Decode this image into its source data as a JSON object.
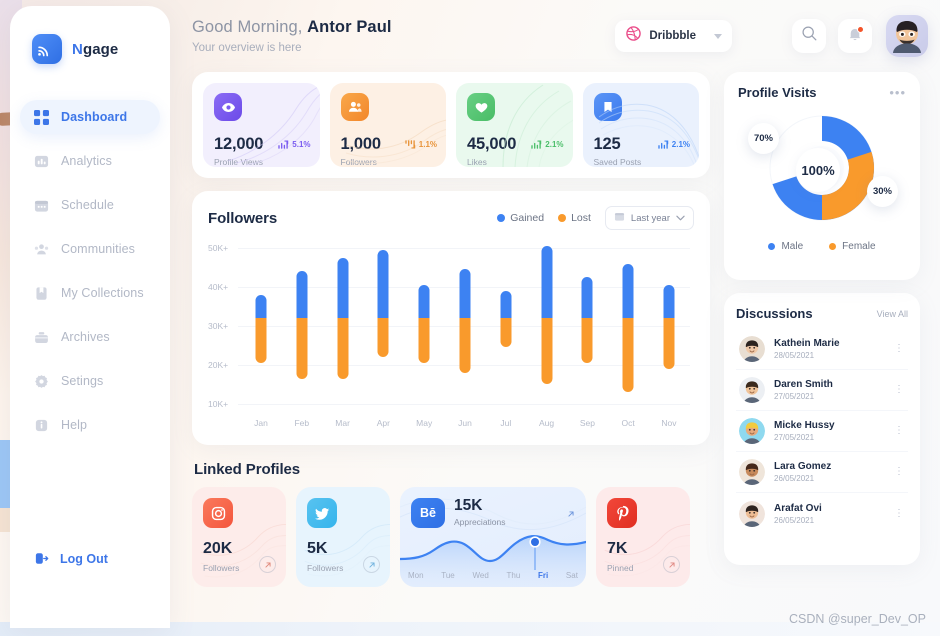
{
  "app": {
    "logo_n": "N",
    "logo_rest": "gage",
    "logo_icon": "cast-icon"
  },
  "sidebar": {
    "items": [
      {
        "label": "Dashboard",
        "icon": "grid-icon",
        "active": true
      },
      {
        "label": "Analytics",
        "icon": "bar-chart-icon",
        "active": false
      },
      {
        "label": "Schedule",
        "icon": "calendar-icon",
        "active": false
      },
      {
        "label": "Communities",
        "icon": "people-icon",
        "active": false
      },
      {
        "label": "My Collections",
        "icon": "bookmark-icon",
        "active": false
      },
      {
        "label": "Archives",
        "icon": "briefcase-icon",
        "active": false
      },
      {
        "label": "Setings",
        "icon": "gear-icon",
        "active": false
      },
      {
        "label": "Help",
        "icon": "info-icon",
        "active": false
      }
    ],
    "logout": {
      "label": "Log Out",
      "icon": "logout-icon"
    }
  },
  "header": {
    "greeting_prefix": "Good Morning, ",
    "user_name": "Antor Paul",
    "subtitle": "Your overview is here",
    "source_pill": {
      "label": "Dribbble",
      "icon": "dribbble-icon",
      "color": "#ea4c89"
    },
    "search_icon": "search-icon",
    "bell_icon": "bell-icon",
    "avatar": "user-avatar"
  },
  "stats": [
    {
      "value": "12,000",
      "label": "Profile Views",
      "change": "5.1%",
      "direction": "up",
      "icon": "eye-icon",
      "accent": "#7a5cf0",
      "bg": "#f1effd",
      "sq_from": "#8b6cf5",
      "sq_to": "#6c4ae8"
    },
    {
      "value": "1,000",
      "label": "Followers",
      "change": "1.1%",
      "direction": "down",
      "icon": "users-icon",
      "accent": "#f2922e",
      "bg": "#fdf0e4",
      "sq_from": "#f9a84a",
      "sq_to": "#f2862a"
    },
    {
      "value": "45,000",
      "label": "Likes",
      "change": "2.1%",
      "direction": "up",
      "icon": "heart-icon",
      "accent": "#4cbf6a",
      "bg": "#e9f9ee",
      "sq_from": "#68cf84",
      "sq_to": "#49bd66"
    },
    {
      "value": "125",
      "label": "Saved Posts",
      "change": "2.1%",
      "direction": "up",
      "icon": "bookmark-icon",
      "accent": "#3d82f2",
      "bg": "#eaf1fd",
      "sq_from": "#5b95f6",
      "sq_to": "#3b7aee"
    }
  ],
  "followers_chart": {
    "title": "Followers",
    "legend": [
      {
        "label": "Gained",
        "color": "#3d82f2"
      },
      {
        "label": "Lost",
        "color": "#f99a2c"
      }
    ],
    "range_select": {
      "label": "Last year",
      "icon": "calendar-icon"
    }
  },
  "chart_data": {
    "type": "bar",
    "title": "Followers",
    "xlabel": "",
    "ylabel": "",
    "ylim": [
      10000,
      52000
    ],
    "yticks": [
      10000,
      20000,
      30000,
      40000,
      50000
    ],
    "ytick_labels": [
      "10K+",
      "20K+",
      "30K+",
      "40K+",
      "50K+"
    ],
    "grid": true,
    "legend_position": "top-right",
    "split_value": 32000,
    "categories": [
      "Jan",
      "Feb",
      "Mar",
      "Apr",
      "May",
      "Jun",
      "Jul",
      "Aug",
      "Sep",
      "Oct",
      "Nov"
    ],
    "series": [
      {
        "name": "Gained",
        "color": "#3d82f2",
        "values": [
          38000,
          44000,
          47500,
          49500,
          40500,
          44500,
          39000,
          50500,
          42500,
          46000,
          40500
        ]
      },
      {
        "name": "Lost",
        "color": "#f99a2c",
        "values": [
          20500,
          16500,
          16500,
          22000,
          20500,
          18000,
          24500,
          15000,
          20500,
          13000,
          19000
        ]
      }
    ]
  },
  "linked_profiles": {
    "title": "Linked Profiles",
    "cards": [
      {
        "network": "Instagram",
        "icon": "instagram-icon",
        "value": "20K",
        "label": "Followers",
        "bg": "#fdecea",
        "sq_from": "#fa7a5c",
        "sq_to": "#f4553d"
      },
      {
        "network": "Twitter",
        "icon": "twitter-icon",
        "value": "5K",
        "label": "Followers",
        "bg": "#e7f4fd",
        "sq_from": "#58c3f0",
        "sq_to": "#35b4ec"
      },
      {
        "network": "Pinterest",
        "icon": "pinterest-icon",
        "value": "7K",
        "label": "Pinned",
        "bg": "#fdeaea",
        "sq_from": "#f2473a",
        "sq_to": "#e02e21"
      }
    ],
    "behance": {
      "network": "Behance",
      "icon": "behance-icon",
      "mark": "Bē",
      "value": "15K",
      "label": "Appreciations",
      "days": [
        "Mon",
        "Tue",
        "Wed",
        "Thu",
        "Fri",
        "Sat"
      ],
      "active_day": "Fri",
      "expand_icon": "arrow-up-right-icon"
    }
  },
  "profile_visits": {
    "title": "Profile Visits",
    "menu_icon": "more-horizontal-icon",
    "center_label": "100%",
    "slices": [
      {
        "label": "Male",
        "value": 70,
        "display": "70%",
        "color": "#3d82f2"
      },
      {
        "label": "Female",
        "value": 30,
        "display": "30%",
        "color": "#f99a2c"
      }
    ]
  },
  "discussions": {
    "title": "Discussions",
    "view_all": "View All",
    "items": [
      {
        "name": "Kathein Marie",
        "date": "28/05/2021",
        "avatar_bg": "#e8ded2",
        "skin": "#f0c9a8",
        "hair": "#2c2420"
      },
      {
        "name": "Daren Smith",
        "date": "27/05/2021",
        "avatar_bg": "#eceff3",
        "skin": "#f0c49a",
        "hair": "#3b2a1e"
      },
      {
        "name": "Micke Hussy",
        "date": "27/05/2021",
        "avatar_bg": "#8fd9ef",
        "skin": "#e7ab7d",
        "hair": "#f2cb3e"
      },
      {
        "name": "Lara Gomez",
        "date": "26/05/2021",
        "avatar_bg": "#efe5da",
        "skin": "#c78a5c",
        "hair": "#45281a"
      },
      {
        "name": "Arafat Ovi",
        "date": "26/05/2021",
        "avatar_bg": "#f0e4dc",
        "skin": "#eebd94",
        "hair": "#2e2420"
      }
    ],
    "row_menu_icon": "more-vertical-icon"
  },
  "watermark": "CSDN @super_Dev_OP"
}
